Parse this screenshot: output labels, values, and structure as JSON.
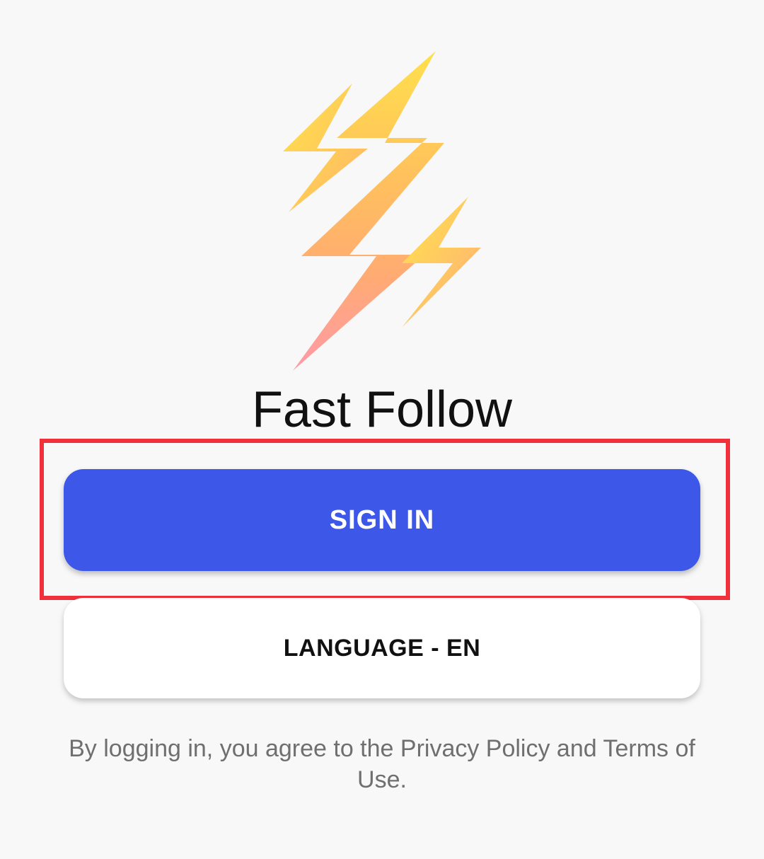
{
  "app": {
    "title": "Fast Follow",
    "logo_icon": "lightning-bolt-logo-icon"
  },
  "actions": {
    "sign_in_label": "SIGN IN",
    "language_label": "LANGUAGE - EN"
  },
  "legal": {
    "text": "By logging in, you agree to the Privacy Policy and Terms of Use."
  },
  "colors": {
    "background": "#f8f8f8",
    "primary_button": "#3d57e8",
    "highlight": "#f0303a",
    "legal_text": "#6f6f6f",
    "logo_yellow": "#ffe04d",
    "logo_orange": "#ffb56b",
    "logo_pink": "#ff9aa8"
  }
}
